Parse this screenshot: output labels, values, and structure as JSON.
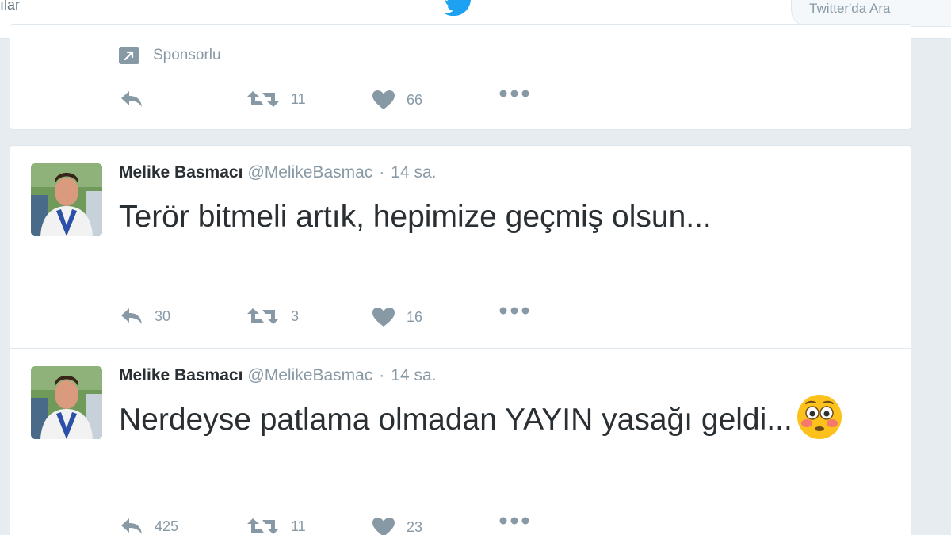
{
  "topbar": {
    "nav_fragment": "ılar",
    "logo_icon": "twitter-bird-icon",
    "search_placeholder": "Twitter'da Ara"
  },
  "promoted_tweet": {
    "sponsored_label": "Sponsorlu",
    "actions": {
      "reply_count": "",
      "retweet_count": "11",
      "like_count": "66"
    }
  },
  "tweets": [
    {
      "fullname": "Melike Basmacı",
      "username": "@MelikeBasmac",
      "separator": "·",
      "time": "14 sa.",
      "text": "Terör bitmeli artık, hepimize geçmiş olsun...",
      "actions": {
        "reply_count": "30",
        "retweet_count": "3",
        "like_count": "16"
      }
    },
    {
      "fullname": "Melike Basmacı",
      "username": "@MelikeBasmac",
      "separator": "·",
      "time": "14 sa.",
      "text": "Nerdeyse patlama olmadan YAYIN yasağı geldi...",
      "emoji": "flushed-face-emoji",
      "actions": {
        "reply_count": "425",
        "retweet_count": "11",
        "like_count": "23"
      }
    }
  ],
  "colors": {
    "background": "#e6ecf0",
    "twitter_blue": "#1da1f2",
    "muted_gray": "#8899a6",
    "text_dark": "#292f33"
  }
}
